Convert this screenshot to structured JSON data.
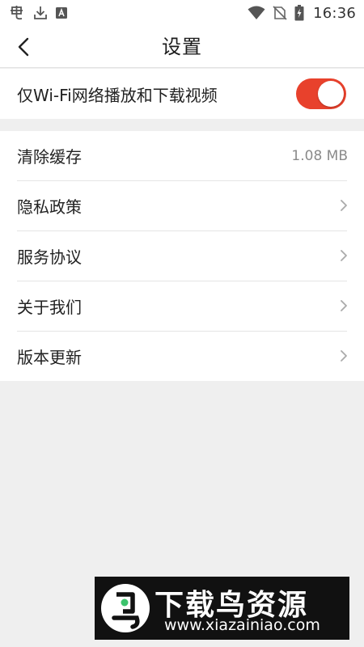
{
  "status_bar": {
    "time": "16:36",
    "left_icons": [
      "app-notification-icon",
      "download-icon",
      "a-box-icon"
    ],
    "right_icons": [
      "wifi-icon",
      "no-sim-icon",
      "battery-charging-icon"
    ]
  },
  "header": {
    "title": "设置",
    "back_icon": "chevron-left-icon"
  },
  "wifi_only": {
    "label": "仅Wi-Fi网络播放和下载视频",
    "enabled": true,
    "toggle_color": "#e8412c"
  },
  "settings": {
    "items": [
      {
        "label": "清除缓存",
        "value": "1.08 MB"
      },
      {
        "label": "隐私政策",
        "icon": "chevron-right-icon"
      },
      {
        "label": "服务协议",
        "icon": "chevron-right-icon"
      },
      {
        "label": "关于我们",
        "icon": "chevron-right-icon"
      },
      {
        "label": "版本更新",
        "icon": "chevron-right-icon"
      }
    ]
  },
  "watermark": {
    "title": "下载鸟资源",
    "url": "www.xiazainiao.com"
  },
  "colors": {
    "accent": "#e8412c",
    "background": "#efefef",
    "surface": "#ffffff",
    "secondary_text": "#8a8a8a"
  }
}
